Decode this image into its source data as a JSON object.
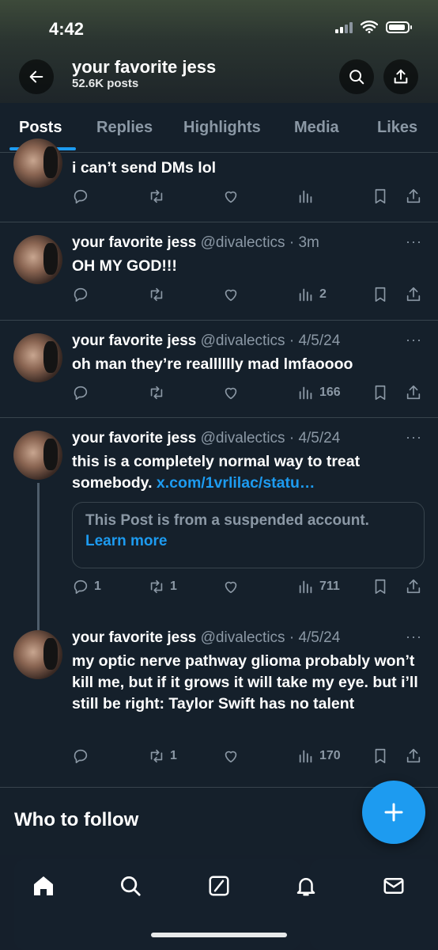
{
  "status_bar": {
    "time": "4:42"
  },
  "header": {
    "name": "your favorite jess",
    "post_count": "52.6K posts"
  },
  "tabs": [
    "Posts",
    "Replies",
    "Highlights",
    "Media",
    "Likes"
  ],
  "posts": [
    {
      "text": "i can’t send DMs lol",
      "replies": "",
      "reposts": "",
      "views": ""
    },
    {
      "name": "your favorite jess",
      "handle_time": "@divalectics · 3m",
      "text": "OH MY GOD!!!",
      "replies": "",
      "reposts": "",
      "views": "2"
    },
    {
      "name": "your favorite jess",
      "handle_time": "@divalectics · 4/5/24",
      "text": "oh man they’re realllllly mad lmfaoooo",
      "replies": "",
      "reposts": "",
      "views": "166"
    },
    {
      "name": "your favorite jess",
      "handle_time": "@divalectics · 4/5/24",
      "text": "this is a completely normal way to treat somebody.",
      "link": "x.com/1vrlilac/statu…",
      "quote_text": "This Post is from a suspended account.",
      "quote_link": "Learn more",
      "replies": "1",
      "reposts": "1",
      "views": "711"
    },
    {
      "name": "your favorite jess",
      "handle_time": "@divalectics · 4/5/24",
      "text": "my optic nerve pathway glioma probably won’t kill me, but if it grows it will take my eye. but i’ll still be right: Taylor Swift has no talent",
      "replies": "",
      "reposts": "1",
      "views": "170"
    }
  ],
  "who_to_follow": "Who to follow",
  "more_glyph": "···",
  "icons": [
    "back-arrow-icon",
    "search-icon",
    "share-icon",
    "reply-icon",
    "repost-icon",
    "like-icon",
    "views-icon",
    "bookmark-icon",
    "home-icon",
    "compose-icon",
    "bell-icon",
    "mail-icon",
    "plus-icon"
  ],
  "colors": {
    "accent": "#1d9bf0",
    "background": "#15202b",
    "muted": "#8b98a5"
  }
}
